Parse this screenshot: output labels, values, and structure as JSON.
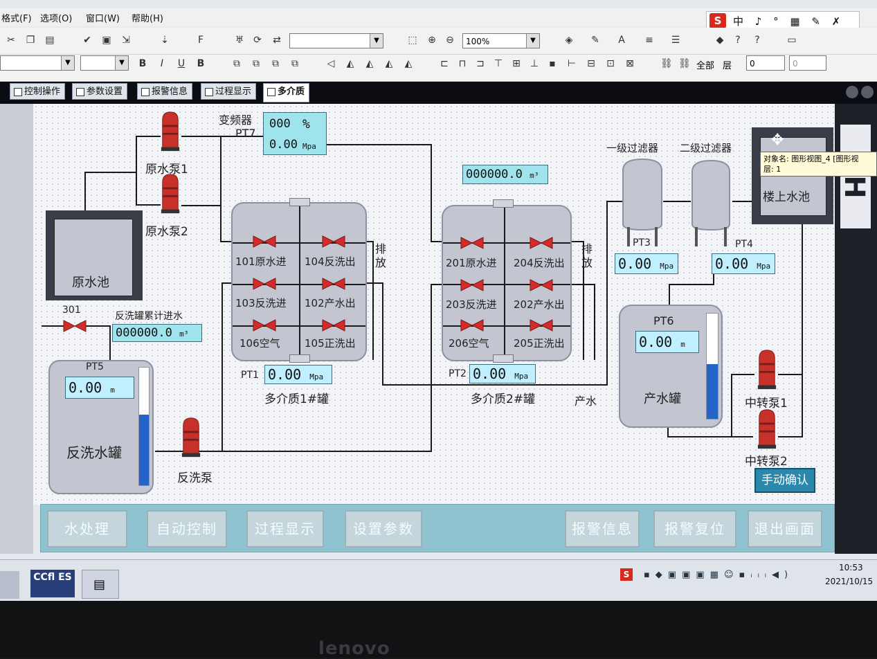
{
  "menu": {
    "format": "格式(F)",
    "options": "选项(O)",
    "window": "窗口(W)",
    "help": "帮助(H)"
  },
  "ime": {
    "logo": "S",
    "status": "中 ♪ ° ▦ ✎ ✗"
  },
  "toolbar": {
    "zoom": "100%",
    "all_label": "全部",
    "layer_label": "层",
    "layer_value": "0",
    "layer_value2": "0"
  },
  "tabs": [
    "控制操作",
    "参数设置",
    "报警信息",
    "过程显示",
    "多介质"
  ],
  "active_tab": "多介质",
  "pumps": {
    "raw1": "原水泵1",
    "raw2": "原水泵2",
    "backwash": "反洗泵",
    "transfer1": "中转泵1",
    "transfer2": "中转泵2"
  },
  "vfd": {
    "label": "变频器",
    "pt": "PT7",
    "percent_value": "000",
    "percent_unit": "%",
    "pressure_value": "0.00",
    "pressure_unit": "Mpa"
  },
  "flow_total": {
    "value": "000000.0",
    "unit": "m³"
  },
  "raw_pool": {
    "label": "原水池"
  },
  "backwash_total": {
    "label": "反洗罐累计进水",
    "value": "000000.0",
    "unit": "m³"
  },
  "valve_301": "301",
  "backwash_tank": {
    "pt": "PT5",
    "value": "0.00",
    "unit": "m",
    "label": "反洗水罐",
    "level_pct": 60
  },
  "tank1": {
    "valves": [
      "101原水进",
      "104反洗出",
      "103反洗进",
      "102产水出",
      "106空气",
      "105正洗出"
    ],
    "discharge": "排放",
    "pt": "PT1",
    "value": "0.00",
    "unit": "Mpa",
    "name": "多介质1#罐"
  },
  "tank2": {
    "valves": [
      "201原水进",
      "204反洗出",
      "203反洗进",
      "202产水出",
      "206空气",
      "205正洗出"
    ],
    "discharge": "排放",
    "pt": "PT2",
    "value": "0.00",
    "unit": "Mpa",
    "name": "多介质2#罐"
  },
  "product_water": "产水",
  "filter1": {
    "label": "一级过滤器",
    "pt": "PT3",
    "value": "0.00",
    "unit": "Mpa"
  },
  "filter2": {
    "label": "二级过滤器",
    "pt": "PT4",
    "value": "0.00",
    "unit": "Mpa"
  },
  "product_tank": {
    "pt": "PT6",
    "value": "0.00",
    "unit": "m",
    "label": "产水罐",
    "level_pct": 52
  },
  "roof_pool": {
    "label": "楼上水池"
  },
  "tooltip": {
    "line1": "对象名: 图形视图_4 [图形视",
    "line2": "层: 1"
  },
  "manual_confirm": "手动确认",
  "side_text": "CH",
  "nav_buttons": [
    "水处理",
    "自动控制",
    "过程显示",
    "设置参数",
    "报警信息",
    "报警复位",
    "退出画面"
  ],
  "taskbar": {
    "time": "10:53",
    "date": "2021/10/15",
    "app_label": "CCfl ES"
  },
  "bezel_brand": "lenovo",
  "colors": {
    "canvas": "#f3f4f7",
    "display": "#9fe4ec",
    "valve": "#d42a2a",
    "pump": "#c8302a",
    "level_fill": "#2463c8",
    "button_bar": "#8fc3cf"
  }
}
